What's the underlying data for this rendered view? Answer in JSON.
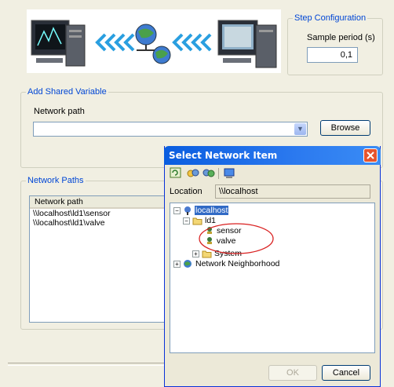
{
  "step_config": {
    "legend": "Step Configuration",
    "sample_period_label": "Sample period (s)",
    "sample_period_value": "0,1"
  },
  "add_shared_variable": {
    "legend": "Add Shared Variable",
    "network_path_label": "Network path",
    "network_path_value": "",
    "browse_label": "Browse"
  },
  "network_paths": {
    "legend": "Network Paths",
    "column_header": "Network path",
    "rows": [
      "\\\\localhost\\ld1\\sensor",
      "\\\\localhost\\ld1\\valve"
    ]
  },
  "dialog": {
    "title": "Select Network Item",
    "location_label": "Location",
    "location_value": "\\\\localhost",
    "tree": {
      "localhost": "localhost",
      "ld1": "ld1",
      "sensor": "sensor",
      "valve": "valve",
      "system": "System",
      "network_neighborhood": "Network Neighborhood"
    },
    "ok_label": "OK",
    "cancel_label": "Cancel"
  },
  "colors": {
    "titlebar_start": "#0a5ddf",
    "titlebar_end": "#3a8cf5",
    "close_button": "#e6542e",
    "highlight_circle": "#d92020",
    "selection": "#316ac5"
  },
  "icons": [
    "computer-icon",
    "globe-network-icon",
    "chevron-arrows-icon",
    "refresh-icon",
    "link-icon",
    "folder-icon",
    "variable-icon",
    "network-icon",
    "close-icon",
    "dropdown-icon"
  ]
}
